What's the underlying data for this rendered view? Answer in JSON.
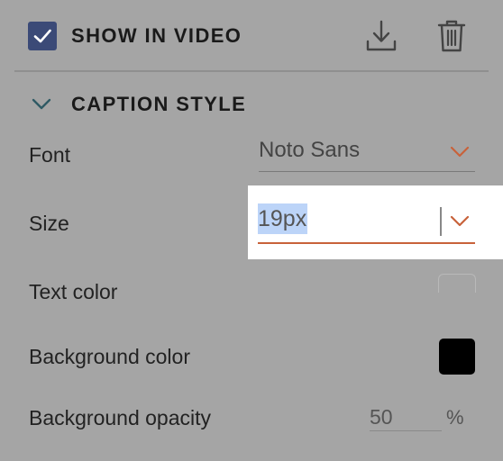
{
  "header": {
    "show_in_video_label": "SHOW IN VIDEO",
    "show_in_video_checked": true,
    "download_icon": "download-icon",
    "delete_icon": "trash-icon"
  },
  "caption_style": {
    "title": "CAPTION STYLE",
    "expanded": true,
    "font": {
      "label": "Font",
      "value": "Noto Sans"
    },
    "size": {
      "label": "Size",
      "value": "19px"
    },
    "text_color": {
      "label": "Text color"
    },
    "background_color": {
      "label": "Background color",
      "value": "#000000"
    },
    "background_opacity": {
      "label": "Background opacity",
      "value": "50",
      "unit": "%"
    }
  },
  "colors": {
    "accent": "#c8623a",
    "checkbox": "#3b4a77",
    "background": "#a5a5a5"
  }
}
